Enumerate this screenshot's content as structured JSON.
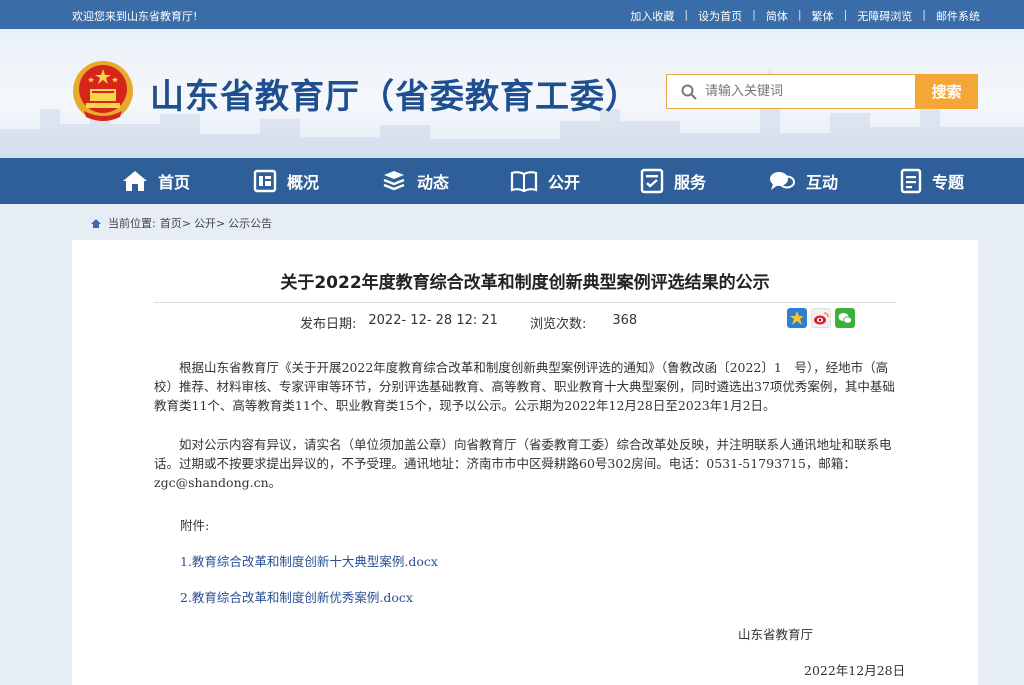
{
  "topbar": {
    "welcome": "欢迎您来到山东省教育厅!",
    "links": [
      "加入收藏",
      "设为首页",
      "简体",
      "繁体",
      "无障碍浏览",
      "邮件系统"
    ]
  },
  "header": {
    "title": "山东省教育厅（省委教育工委）",
    "search_placeholder": "请输入关键词",
    "search_button": "搜索"
  },
  "nav": {
    "items": [
      {
        "label": "首页",
        "icon": "home-icon"
      },
      {
        "label": "概况",
        "icon": "overview-icon"
      },
      {
        "label": "动态",
        "icon": "news-icon"
      },
      {
        "label": "公开",
        "icon": "book-icon"
      },
      {
        "label": "服务",
        "icon": "service-icon"
      },
      {
        "label": "互动",
        "icon": "chat-icon"
      },
      {
        "label": "专题",
        "icon": "topic-icon"
      }
    ]
  },
  "breadcrumb": {
    "prefix": "当前位置:",
    "items": [
      "首页",
      "公开",
      "公示公告"
    ],
    "sep": ">"
  },
  "article": {
    "title": "关于2022年度教育综合改革和制度创新典型案例评选结果的公示",
    "date_label": "发布日期:",
    "date_value": "2022- 12- 28 12: 21",
    "views_label": "浏览次数:",
    "views_value": "368",
    "para1": "根据山东省教育厅《关于开展2022年度教育综合改革和制度创新典型案例评选的通知》（鲁教改函〔2022〕1　号），经地市（高校）推荐、材料审核、专家评审等环节，分别评选基础教育、高等教育、职业教育十大典型案例，同时遴选出37项优秀案例，其中基础教育类11个、高等教育类11个、职业教育类15个，现予以公示。公示期为2022年12月28日至2023年1月2日。",
    "para2": "如对公示内容有异议，请实名（单位须加盖公章）向省教育厅（省委教育工委）综合改革处反映，并注明联系人通讯地址和联系电话。过期或不按要求提出异议的，不予受理。通讯地址：济南市市中区舜耕路60号302房间。电话：0531-51793715，邮箱：zgc@shandong.cn。",
    "attach_label": "附件:",
    "attachments": [
      "1.教育综合改革和制度创新十大典型案例.docx",
      "2.教育综合改革和制度创新优秀案例.docx"
    ],
    "signature": "山东省教育厅",
    "sign_date": "2022年12月28日"
  },
  "share": [
    "qzone-icon",
    "weibo-icon",
    "wechat-icon"
  ],
  "colors": {
    "topbar": "#3a6ca8",
    "nav": "#2e5f98",
    "title_blue": "#1f4f8e",
    "accent_orange": "#f4a637",
    "link_blue": "#2a4f93"
  }
}
